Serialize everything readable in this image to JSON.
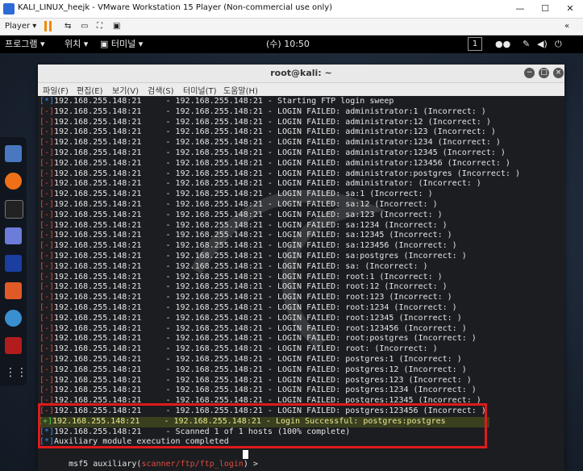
{
  "vmware": {
    "title": "KALI_LINUX_heejk - VMware Workstation 15 Player (Non-commercial use only)",
    "player_label": "Player ▾",
    "window_buttons": [
      "—",
      "☐",
      "✕"
    ]
  },
  "kali_panel": {
    "programs": "프로그램 ▾",
    "places": "위치 ▾",
    "terminal": "터미널 ▾",
    "clock": "(수) 10:50",
    "workspace": "1"
  },
  "terminal": {
    "title": "root@kali: ~",
    "menu": [
      "파일(F)",
      "편집(E)",
      "보기(V)",
      "검색(S)",
      "터미널(T)",
      "도움말(H)"
    ],
    "lines": [
      {
        "mk": "[*]",
        "type": "info",
        "text": "192.168.255.148:21     - 192.168.255.148:21 - Starting FTP login sweep"
      },
      {
        "mk": "[-]",
        "type": "err",
        "text": "192.168.255.148:21     - 192.168.255.148:21 - LOGIN FAILED: administrator:1 (Incorrect: )"
      },
      {
        "mk": "[-]",
        "type": "err",
        "text": "192.168.255.148:21     - 192.168.255.148:21 - LOGIN FAILED: administrator:12 (Incorrect: )"
      },
      {
        "mk": "[-]",
        "type": "err",
        "text": "192.168.255.148:21     - 192.168.255.148:21 - LOGIN FAILED: administrator:123 (Incorrect: )"
      },
      {
        "mk": "[-]",
        "type": "err",
        "text": "192.168.255.148:21     - 192.168.255.148:21 - LOGIN FAILED: administrator:1234 (Incorrect: )"
      },
      {
        "mk": "[-]",
        "type": "err",
        "text": "192.168.255.148:21     - 192.168.255.148:21 - LOGIN FAILED: administrator:12345 (Incorrect: )"
      },
      {
        "mk": "[-]",
        "type": "err",
        "text": "192.168.255.148:21     - 192.168.255.148:21 - LOGIN FAILED: administrator:123456 (Incorrect: )"
      },
      {
        "mk": "[-]",
        "type": "err",
        "text": "192.168.255.148:21     - 192.168.255.148:21 - LOGIN FAILED: administrator:postgres (Incorrect: )"
      },
      {
        "mk": "[-]",
        "type": "err",
        "text": "192.168.255.148:21     - 192.168.255.148:21 - LOGIN FAILED: administrator: (Incorrect: )"
      },
      {
        "mk": "[-]",
        "type": "err",
        "text": "192.168.255.148:21     - 192.168.255.148:21 - LOGIN FAILED: sa:1 (Incorrect: )"
      },
      {
        "mk": "[-]",
        "type": "err",
        "text": "192.168.255.148:21     - 192.168.255.148:21 - LOGIN FAILED: sa:12 (Incorrect: )"
      },
      {
        "mk": "[-]",
        "type": "err",
        "text": "192.168.255.148:21     - 192.168.255.148:21 - LOGIN FAILED: sa:123 (Incorrect: )"
      },
      {
        "mk": "[-]",
        "type": "err",
        "text": "192.168.255.148:21     - 192.168.255.148:21 - LOGIN FAILED: sa:1234 (Incorrect: )"
      },
      {
        "mk": "[-]",
        "type": "err",
        "text": "192.168.255.148:21     - 192.168.255.148:21 - LOGIN FAILED: sa:12345 (Incorrect: )"
      },
      {
        "mk": "[-]",
        "type": "err",
        "text": "192.168.255.148:21     - 192.168.255.148:21 - LOGIN FAILED: sa:123456 (Incorrect: )"
      },
      {
        "mk": "[-]",
        "type": "err",
        "text": "192.168.255.148:21     - 192.168.255.148:21 - LOGIN FAILED: sa:postgres (Incorrect: )"
      },
      {
        "mk": "[-]",
        "type": "err",
        "text": "192.168.255.148:21     - 192.168.255.148:21 - LOGIN FAILED: sa: (Incorrect: )"
      },
      {
        "mk": "[-]",
        "type": "err",
        "text": "192.168.255.148:21     - 192.168.255.148:21 - LOGIN FAILED: root:1 (Incorrect: )"
      },
      {
        "mk": "[-]",
        "type": "err",
        "text": "192.168.255.148:21     - 192.168.255.148:21 - LOGIN FAILED: root:12 (Incorrect: )"
      },
      {
        "mk": "[-]",
        "type": "err",
        "text": "192.168.255.148:21     - 192.168.255.148:21 - LOGIN FAILED: root:123 (Incorrect: )"
      },
      {
        "mk": "[-]",
        "type": "err",
        "text": "192.168.255.148:21     - 192.168.255.148:21 - LOGIN FAILED: root:1234 (Incorrect: )"
      },
      {
        "mk": "[-]",
        "type": "err",
        "text": "192.168.255.148:21     - 192.168.255.148:21 - LOGIN FAILED: root:12345 (Incorrect: )"
      },
      {
        "mk": "[-]",
        "type": "err",
        "text": "192.168.255.148:21     - 192.168.255.148:21 - LOGIN FAILED: root:123456 (Incorrect: )"
      },
      {
        "mk": "[-]",
        "type": "err",
        "text": "192.168.255.148:21     - 192.168.255.148:21 - LOGIN FAILED: root:postgres (Incorrect: )"
      },
      {
        "mk": "[-]",
        "type": "err",
        "text": "192.168.255.148:21     - 192.168.255.148:21 - LOGIN FAILED: root: (Incorrect: )"
      },
      {
        "mk": "[-]",
        "type": "err",
        "text": "192.168.255.148:21     - 192.168.255.148:21 - LOGIN FAILED: postgres:1 (Incorrect: )"
      },
      {
        "mk": "[-]",
        "type": "err",
        "text": "192.168.255.148:21     - 192.168.255.148:21 - LOGIN FAILED: postgres:12 (Incorrect: )"
      },
      {
        "mk": "[-]",
        "type": "err",
        "text": "192.168.255.148:21     - 192.168.255.148:21 - LOGIN FAILED: postgres:123 (Incorrect: )"
      },
      {
        "mk": "[-]",
        "type": "err",
        "text": "192.168.255.148:21     - 192.168.255.148:21 - LOGIN FAILED: postgres:1234 (Incorrect: )"
      },
      {
        "mk": "[-]",
        "type": "err",
        "text": "192.168.255.148:21     - 192.168.255.148:21 - LOGIN FAILED: postgres:12345 (Incorrect: )"
      },
      {
        "mk": "[-]",
        "type": "err",
        "text": "192.168.255.148:21     - 192.168.255.148:21 - LOGIN FAILED: postgres:123456 (Incorrect: )"
      },
      {
        "mk": "[+]",
        "type": "ok",
        "text": "192.168.255.148:21     - 192.168.255.148:21 - Login Successful: postgres:postgres",
        "highlight": true
      },
      {
        "mk": "[*]",
        "type": "info",
        "text": "192.168.255.148:21     - Scanned 1 of 1 hosts (100% complete)"
      },
      {
        "mk": "[*]",
        "type": "info",
        "text": "Auxiliary module execution completed"
      }
    ],
    "prompt_prefix": "msf5 auxiliary(",
    "prompt_module": "scanner/ftp/ftp_login",
    "prompt_suffix": ") > "
  },
  "colors": {
    "error": "#e14a3a",
    "success": "#4ad04a",
    "info": "#3c8cf0",
    "highlight_box": "#e01a1a"
  }
}
